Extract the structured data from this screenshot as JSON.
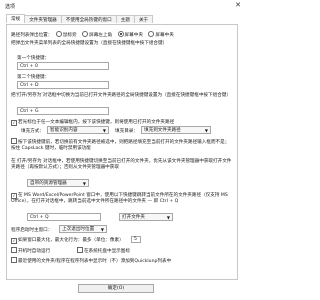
{
  "window": {
    "title": "选项",
    "close_glyph": "✕"
  },
  "tabs": [
    "常规",
    "文件夹管理器",
    "不使用全局热键的窗口",
    "主题",
    "关于"
  ],
  "general": {
    "popup_position_label": "路径列表弹出位置：",
    "popup_options": [
      "鼠标旁",
      "屏幕左上角",
      "屏幕中央"
    ],
    "popup_selected_index": 2,
    "popup_tail_label": "屏幕中央",
    "hotkey_group_desc": "把弹出文件夹菜单列表的全局快捷键设置为（直接在快捷键框中按下组合键）",
    "hotkey1_label": "第一个快捷键：",
    "hotkey1_value": "Ctrl + 0",
    "hotkey2_label": "第二个快捷键：",
    "hotkey2_value": "Ctrl + D",
    "open_cmd_desc": "把'打开/另存为'对话框中切换为当前已打开文件夹路径的全局快捷键设置为（直接在快捷键框中按下组合键）",
    "open_cmd_value": "Ctrl + G",
    "auto_switch_label": "若光标位于任一文本编辑框内，按下该快捷键，则将使用已打开的文件夹路径",
    "auto_switch_checked": true,
    "fill_method_label": "填充方式：",
    "fill_method_value": "智能识别内容",
    "fill_method2_label": "填充目录：",
    "fill_method2_value": "填充到文件夹路径",
    "ctrl_note": "按下该快捷键前，若切换前有文件夹路径被选中，则把路径填充至当前打开的文件夹路径输入框而不是；按住 CapsLock 键时，临时禁用该功能",
    "ctrl_note_checked": false,
    "filedialog_desc": "在 打开/另存为 对话框中，若使用快捷键切换至当前已打开的文件夹，优先从该文件夹管理器中获取打开文件夹路径（再按默认方式）；否则从文件夹管理器中获取",
    "filedialog_select": "自带的资源管理器",
    "office_label": "在 MS Word/Excel/PowerPoint 窗口中，使用以下快捷键跳转当前文件所在的文件夹路径（仅支持 MS Office），在打开对话框中，跳转当前选中文件所在路径中的文件夹 — 即 Ctrl + Q ",
    "office_checked": true,
    "office_hotkey": "Ctrl + Q",
    "office_action": "打开文件夹",
    "close_explorer_label": "程序启动时主窗口：",
    "close_explorer_value": "上次退出时位置",
    "restore_label": "如果窗口最大化，最大化行为：最多（单位：像素）",
    "restore_checked": true,
    "restore_value": "5",
    "startup_label": "开机时自动运行",
    "startup_checked": false,
    "tray_label": "在系统托盘中显示图标",
    "tray_checked": false,
    "extra_label": "最近使用的文件夹/程序在程序列表中显示时（不）添加到Quicklunp列表中",
    "extra_checked": false,
    "confirm_label": "确定(O)"
  }
}
